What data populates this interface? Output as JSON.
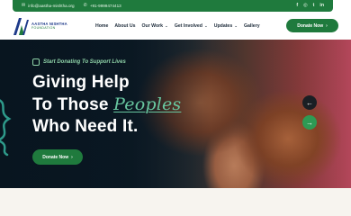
{
  "topbar": {
    "email": "info@aastha-mishtha.org",
    "phone": "+91-9999474413",
    "socials": [
      {
        "name": "facebook-icon",
        "glyph": "f"
      },
      {
        "name": "instagram-icon",
        "glyph": "◎"
      },
      {
        "name": "twitter-icon",
        "glyph": "t"
      },
      {
        "name": "linkedin-icon",
        "glyph": "in"
      }
    ]
  },
  "logo": {
    "line1": "AASTHA NISHTHA",
    "line2": "FOUNDATION"
  },
  "nav": {
    "items": [
      {
        "label": "Home",
        "dropdown": false
      },
      {
        "label": "About Us",
        "dropdown": false
      },
      {
        "label": "Our Work",
        "dropdown": true
      },
      {
        "label": "Get Involved",
        "dropdown": true
      },
      {
        "label": "Updates",
        "dropdown": true
      },
      {
        "label": "Gallery",
        "dropdown": false
      }
    ],
    "donate_label": "Donate Now"
  },
  "hero": {
    "kicker": "Start Donating To Support Lives",
    "line1": "Giving Help",
    "line2_a": "To Those ",
    "line2_accent": "Peoples",
    "line3": "Who Need It.",
    "button_label": "Donate Now"
  },
  "colors": {
    "brand_green": "#1f7a3d",
    "accent_teal": "#68c7a0",
    "navy": "#1e3a8a"
  }
}
